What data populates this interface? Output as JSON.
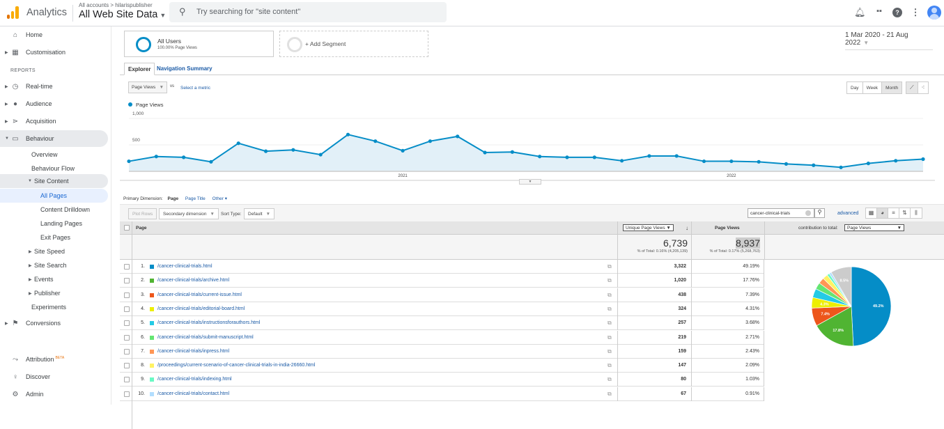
{
  "header": {
    "app_name": "Analytics",
    "breadcrumb": "All accounts > hilarispublisher",
    "property": "All Web Site Data",
    "search_placeholder": "Try searching for \"site content\"",
    "icons": [
      "notifications-icon",
      "apps-icon",
      "help-icon",
      "more-vert-icon",
      "account-avatar"
    ]
  },
  "sidebar": {
    "top_items": [
      {
        "label": "Home",
        "icon": "home-icon"
      },
      {
        "label": "Customisation",
        "icon": "dashboard-icon"
      }
    ],
    "reports_heading": "REPORTS",
    "report_items": [
      {
        "label": "Real-time",
        "icon": "clock-icon"
      },
      {
        "label": "Audience",
        "icon": "person-icon"
      },
      {
        "label": "Acquisition",
        "icon": "acquisition-icon"
      },
      {
        "label": "Behaviour",
        "icon": "behaviour-icon"
      }
    ],
    "behaviour_sub": [
      "Overview",
      "Behaviour Flow",
      "Site Content"
    ],
    "site_content_sub": [
      "All Pages",
      "Content Drilldown",
      "Landing Pages",
      "Exit Pages"
    ],
    "behaviour_more": [
      "Site Speed",
      "Site Search",
      "Events",
      "Publisher",
      "Experiments"
    ],
    "conversions": "Conversions",
    "bottom_items": [
      {
        "label": "Attribution",
        "badge": "BETA",
        "icon": "attribution-icon"
      },
      {
        "label": "Discover",
        "icon": "lightbulb-icon"
      },
      {
        "label": "Admin",
        "icon": "gear-icon"
      }
    ]
  },
  "segments": {
    "active_name": "All Users",
    "active_sub": "100.00% Page Views",
    "add_label": "+ Add Segment"
  },
  "date_range": "1 Mar 2020 - 21 Aug 2022",
  "tabs": [
    "Explorer",
    "Navigation Summary"
  ],
  "metric_selector": {
    "value": "Page Views",
    "vs": "vs",
    "select_label": "Select a metric"
  },
  "granularity": {
    "options": [
      "Day",
      "Week",
      "Month"
    ],
    "selected": "Month"
  },
  "chart_data": {
    "type": "line",
    "title": "",
    "legend": [
      "Page Views"
    ],
    "series": [
      {
        "name": "Page Views",
        "color": "#058dc7",
        "values": [
          190,
          280,
          265,
          180,
          530,
          380,
          405,
          315,
          695,
          570,
          390,
          570,
          660,
          355,
          365,
          280,
          265,
          265,
          200,
          290,
          290,
          190,
          190,
          180,
          140,
          115,
          75,
          150,
          200,
          230
        ]
      }
    ],
    "x": [
      "Mar 2020",
      "Apr 2020",
      "May 2020",
      "Jun 2020",
      "Jul 2020",
      "Aug 2020",
      "Sep 2020",
      "Oct 2020",
      "Nov 2020",
      "Dec 2020",
      "Jan 2021",
      "Feb 2021",
      "Mar 2021",
      "Apr 2021",
      "May 2021",
      "Jun 2021",
      "Jul 2021",
      "Aug 2021",
      "Sep 2021",
      "Oct 2021",
      "Nov 2021",
      "Dec 2021",
      "Jan 2022",
      "Feb 2022",
      "Mar 2022",
      "Apr 2022",
      "May 2022",
      "Jun 2022",
      "Jul 2022",
      "Aug 2022"
    ],
    "x_tick_labels": [
      {
        "label": "2021",
        "at_index": 10
      },
      {
        "label": "2022",
        "at_index": 22
      }
    ],
    "y_ticks": [
      {
        "value": 500,
        "label": "500"
      },
      {
        "value": 1000,
        "label": "1,000"
      }
    ],
    "ylim": [
      0,
      1000
    ],
    "grid": true
  },
  "primary_dimension": {
    "label": "Primary Dimension:",
    "current": "Page",
    "options": [
      "Page Title",
      "Other"
    ]
  },
  "toolbar": {
    "plot_rows": "Plot Rows",
    "secondary_dimension": "Secondary dimension",
    "sort_type_label": "Sort Type:",
    "sort_type_value": "Default",
    "filter_value": "cancer-clinical-trials",
    "advanced": "advanced"
  },
  "table": {
    "col_page": "Page",
    "col_metric1": "Unique Page Views",
    "col_metric2": "Page Views",
    "col_contribution": "contribution to total:",
    "contribution_metric": "Page Views",
    "totals": {
      "metric1": "6,739",
      "metric1_sub": "% of Total: 0.16% (4,205,139)",
      "metric2": "8,937",
      "metric2_sub": "% of Total: 0.17% (5,268,763)"
    },
    "rows": [
      {
        "n": "1.",
        "page": "/cancer-clinical-trials.html",
        "upv": "3,322",
        "pv_pct": "49.19%",
        "color": "#058dc7"
      },
      {
        "n": "2.",
        "page": "/cancer-clinical-trials/archive.html",
        "upv": "1,020",
        "pv_pct": "17.76%",
        "color": "#50b432"
      },
      {
        "n": "3.",
        "page": "/cancer-clinical-trials/current-issue.html",
        "upv": "438",
        "pv_pct": "7.39%",
        "color": "#ed561b"
      },
      {
        "n": "4.",
        "page": "/cancer-clinical-trials/editorial-board.html",
        "upv": "324",
        "pv_pct": "4.31%",
        "color": "#edef00"
      },
      {
        "n": "5.",
        "page": "/cancer-clinical-trials/instructionsforauthors.html",
        "upv": "257",
        "pv_pct": "3.68%",
        "color": "#24cbe5"
      },
      {
        "n": "6.",
        "page": "/cancer-clinical-trials/submit-manuscript.html",
        "upv": "219",
        "pv_pct": "2.71%",
        "color": "#64e572"
      },
      {
        "n": "7.",
        "page": "/cancer-clinical-trials/inpress.html",
        "upv": "159",
        "pv_pct": "2.43%",
        "color": "#ff9655"
      },
      {
        "n": "8.",
        "page": "/proceedings/current-scenario-of-cancer-clinical-trials-in-india-26660.html",
        "upv": "147",
        "pv_pct": "2.09%",
        "color": "#fff263"
      },
      {
        "n": "9.",
        "page": "/cancer-clinical-trials/indexing.html",
        "upv": "80",
        "pv_pct": "1.03%",
        "color": "#6af9c4"
      },
      {
        "n": "10.",
        "page": "/cancer-clinical-trials/contact.html",
        "upv": "67",
        "pv_pct": "0.91%",
        "color": "#b2deff"
      }
    ],
    "pie": {
      "other_color": "#cccccc",
      "other_pct": 8.5,
      "labels": [
        "49.2%",
        "17.8%",
        "7.4%",
        "4.3%",
        "",
        "",
        "",
        "",
        "",
        "",
        "8.5%"
      ]
    }
  }
}
